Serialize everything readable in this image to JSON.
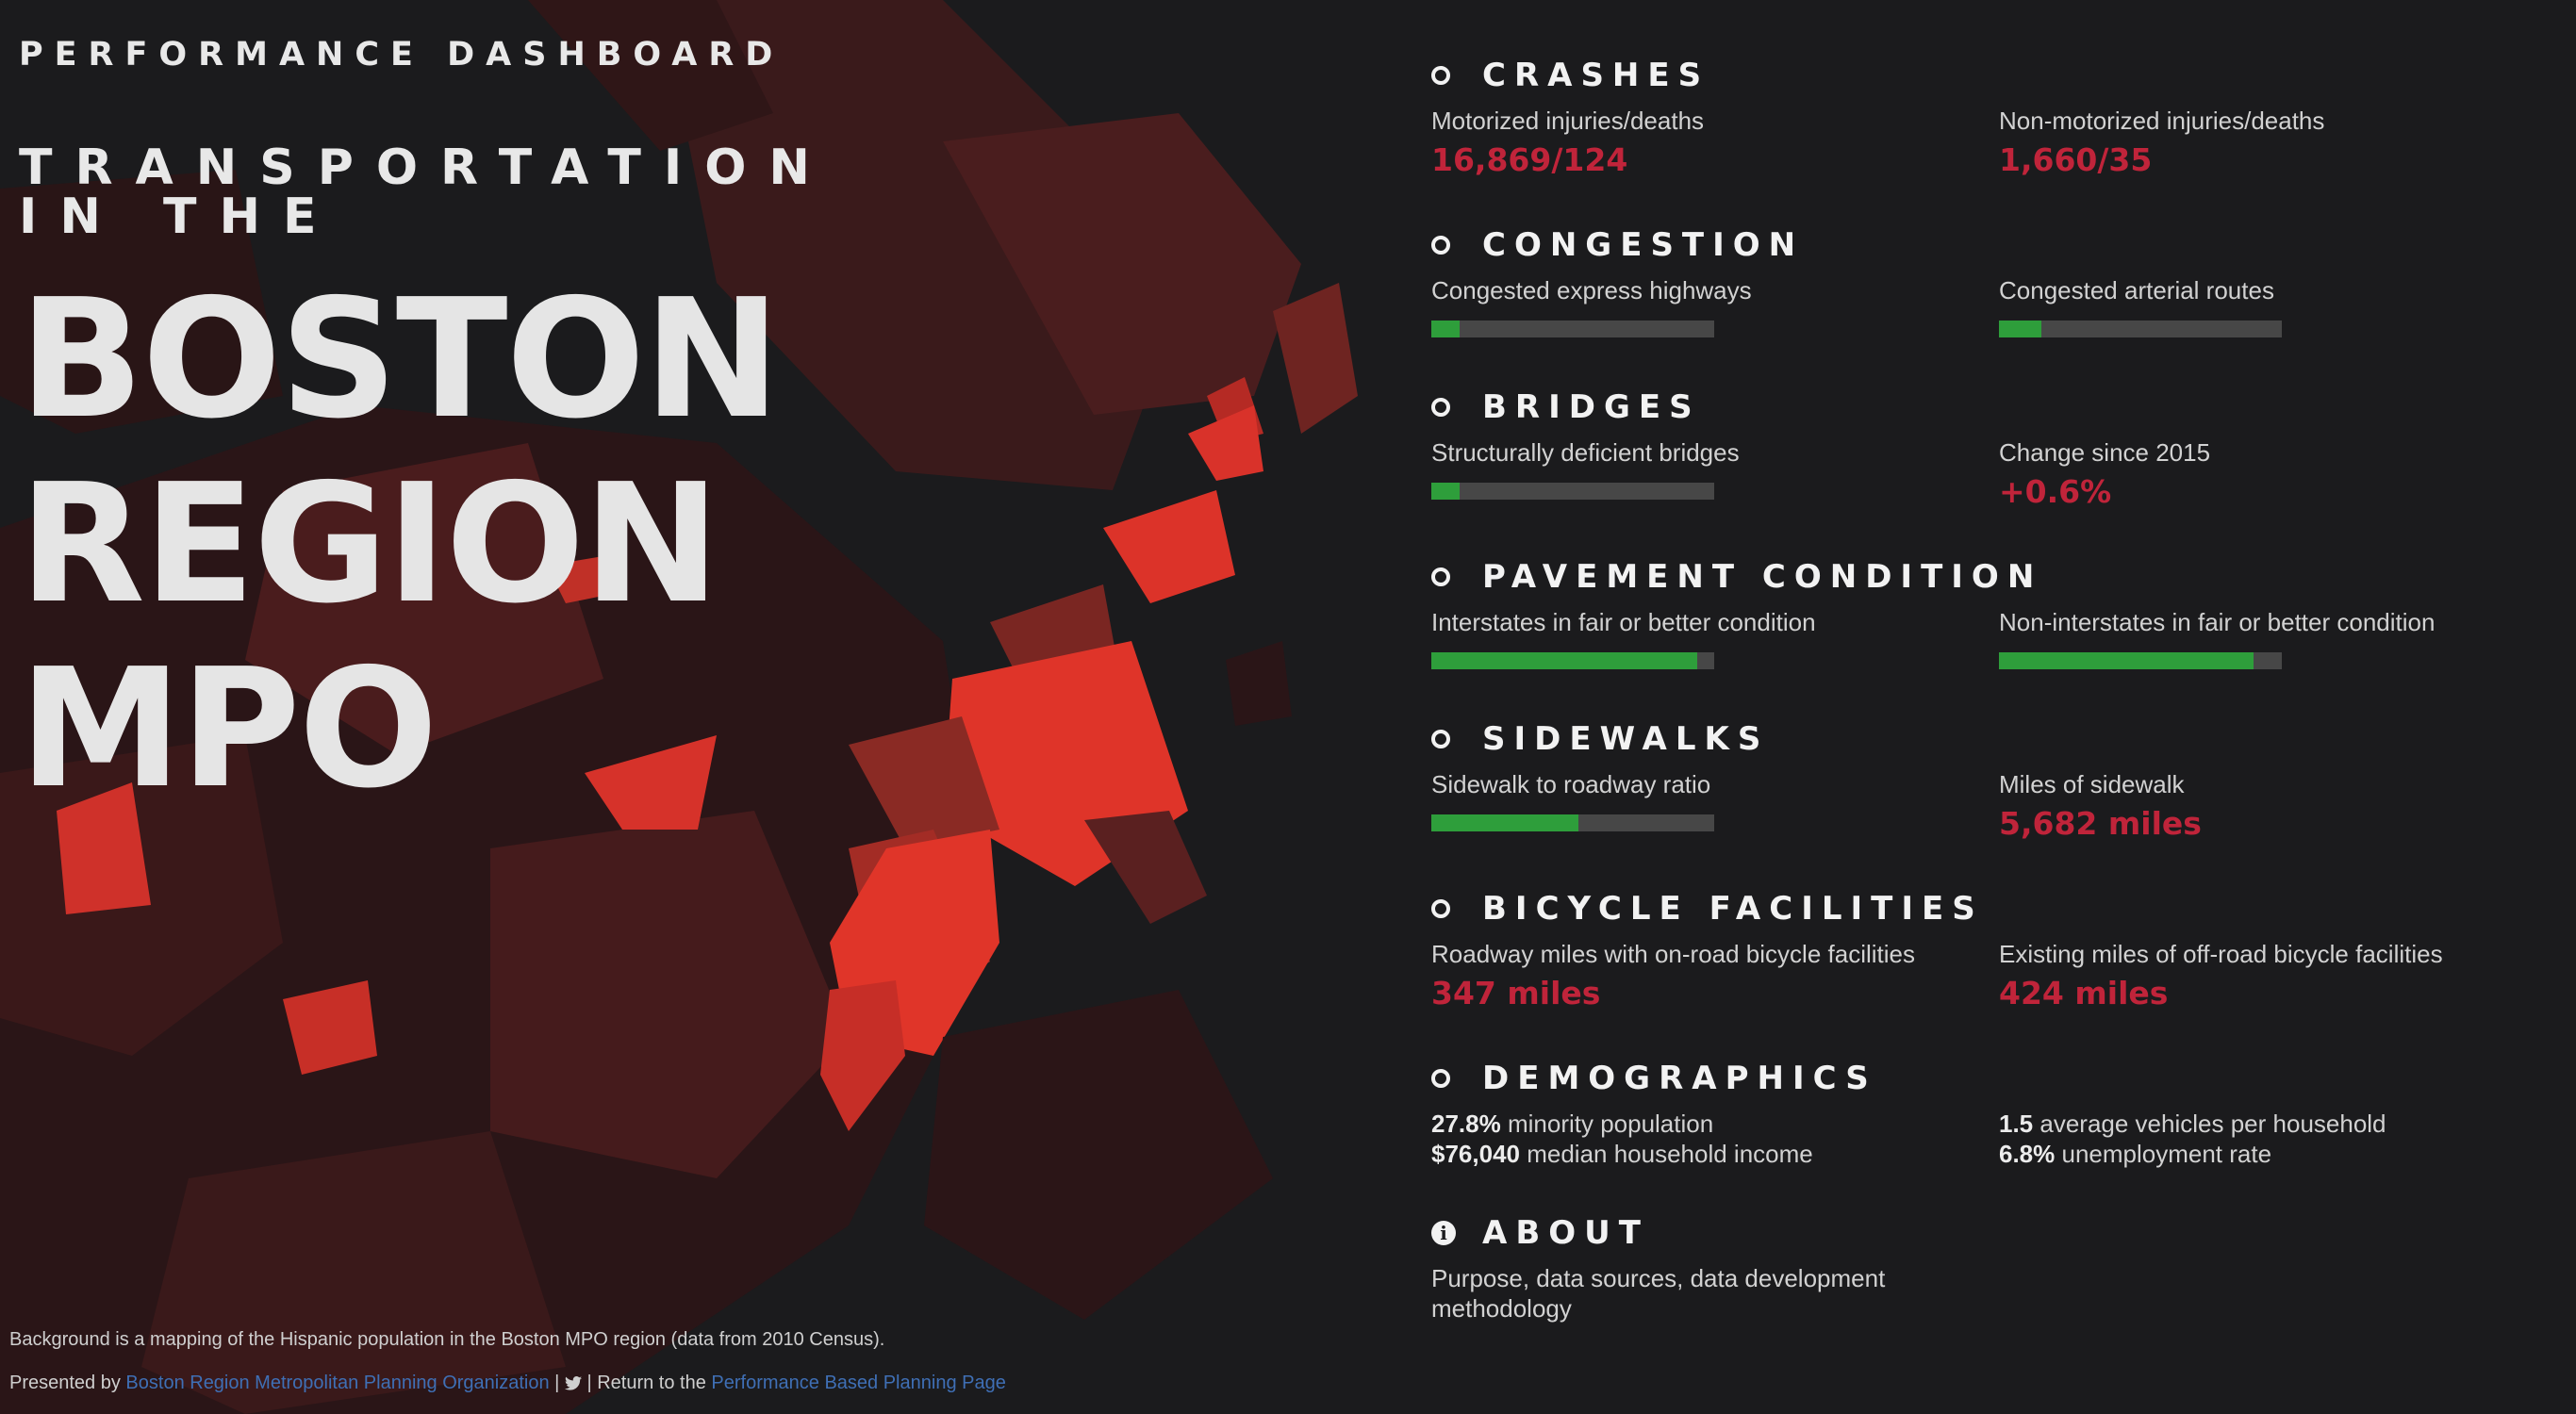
{
  "header": {
    "kicker": "PERFORMANCE DASHBOARD",
    "subtitle": "TRANSPORTATION IN THE",
    "title_lines": [
      "BOSTON",
      "REGION",
      "MPO"
    ]
  },
  "sections": {
    "crashes": {
      "title": "CRASHES",
      "left": {
        "label": "Motorized injuries/deaths",
        "value": "16,869/124"
      },
      "right": {
        "label": "Non-motorized injuries/deaths",
        "value": "1,660/35"
      }
    },
    "congestion": {
      "title": "CONGESTION",
      "left": {
        "label": "Congested express highways",
        "fraction": 0.1
      },
      "right": {
        "label": "Congested arterial routes",
        "fraction": 0.15
      }
    },
    "bridges": {
      "title": "BRIDGES",
      "left": {
        "label": "Structurally deficient bridges",
        "fraction": 0.1
      },
      "right": {
        "label": "Change since 2015",
        "value": "+0.6%"
      }
    },
    "pavement": {
      "title": "PAVEMENT CONDITION",
      "left": {
        "label": "Interstates in fair or better condition",
        "fraction": 0.94
      },
      "right": {
        "label": "Non-interstates in fair or better condition",
        "fraction": 0.9
      }
    },
    "sidewalks": {
      "title": "SIDEWALKS",
      "left": {
        "label": "Sidewalk to roadway ratio",
        "fraction": 0.52
      },
      "right": {
        "label": "Miles of sidewalk",
        "value": "5,682 miles"
      }
    },
    "bicycle": {
      "title": "BICYCLE FACILITIES",
      "left": {
        "label": "Roadway miles with on-road bicycle facilities",
        "value": "347 miles"
      },
      "right": {
        "label": "Existing miles of off-road bicycle facilities",
        "value": "424 miles"
      }
    },
    "demographics": {
      "title": "DEMOGRAPHICS",
      "minority_value": "27.8%",
      "minority_label": " minority population",
      "income_value": "$76,040",
      "income_label": " median household income",
      "vehicles_value": "1.5",
      "vehicles_label": " average vehicles per household",
      "unemployment_value": "6.8%",
      "unemployment_label": " unemployment rate"
    },
    "about": {
      "title": "ABOUT",
      "text": "Purpose, data sources, data development methodology"
    }
  },
  "footer": {
    "note": "Background is a mapping of the Hispanic population in the Boston MPO region (data from 2010 Census).",
    "presented_by": "Presented by ",
    "org_link": "Boston Region Metropolitan Planning Organization",
    "sep1": " | ",
    "sep2": " | Return to the ",
    "pbp_link": "Performance Based Planning Page"
  },
  "colors": {
    "background": "#1b1b1d",
    "accent_red": "#c0243a",
    "bar_green": "#2e9e3b",
    "bar_track": "#474747"
  },
  "icons": {
    "section": "circle-outline-icon",
    "about": "info-icon",
    "twitter": "twitter-icon"
  }
}
